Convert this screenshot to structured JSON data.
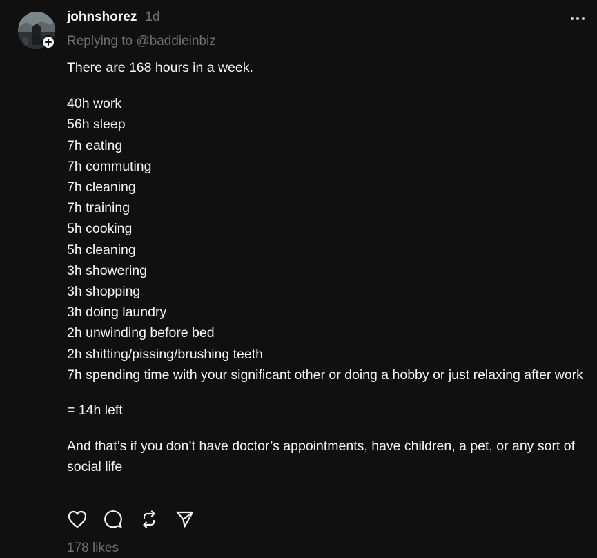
{
  "post": {
    "username": "johnshorez",
    "time": "1d",
    "replying_to": "Replying to @baddieinbiz",
    "intro": "There are 168 hours in a week.",
    "items": [
      "40h work",
      "56h sleep",
      "7h eating",
      "7h commuting",
      "7h cleaning",
      "7h training",
      "5h cooking",
      "5h cleaning",
      "3h showering",
      "3h shopping",
      "3h doing laundry",
      "2h unwinding before bed",
      "2h shitting/pissing/brushing teeth",
      "7h spending time with your significant other or doing a hobby or just relaxing after work"
    ],
    "result": "= 14h left",
    "closing": "And that’s if you don’t have doctor’s appointments, have children, a pet, or any sort of social life",
    "likes": "178 likes"
  },
  "icons": {
    "more": "more-horizontal-icon",
    "like": "heart-icon",
    "comment": "comment-icon",
    "repost": "repost-icon",
    "share": "send-icon",
    "follow": "plus-icon"
  },
  "colors": {
    "background": "#101010",
    "text": "#f3f5f7",
    "secondary_text": "#6f6f6f"
  }
}
